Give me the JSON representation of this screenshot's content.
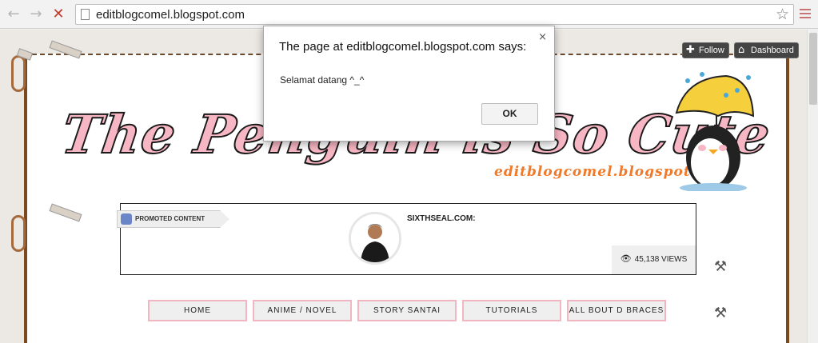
{
  "browser": {
    "url": "editblogcomel.blogspot.com",
    "back_icon": "←",
    "forward_icon": "→",
    "stop_icon": "✕",
    "star_icon": "☆"
  },
  "blog_nav": {
    "follow_label": "Follow",
    "follow_icon": "✚",
    "dashboard_label": "Dashboard",
    "dashboard_icon": "⌂"
  },
  "header": {
    "title": "The Penguin is So Cute",
    "subtitle": "editblogcomel.blogspot.com"
  },
  "promo": {
    "tag": "PROMOTED CONTENT",
    "source": "SIXTHSEAL.COM:",
    "views": "45,138 VIEWS",
    "eye_icon": "👁"
  },
  "tools": {
    "icon": "⚒"
  },
  "menu": {
    "tabs": [
      "HOME",
      "ANIME / NOVEL",
      "STORY SANTAI",
      "TUTORIALS",
      "ALL BOUT D BRACES"
    ]
  },
  "dialog": {
    "heading": "The page at editblogcomel.blogspot.com says:",
    "message": "Selamat datang ^_^",
    "ok_label": "OK",
    "close_icon": "×"
  },
  "colors": {
    "title_fill": "#f7b6c3",
    "subtitle": "#f07a2a",
    "tab_border": "#f2b5c2",
    "frame_brown": "#7a4a1e"
  }
}
